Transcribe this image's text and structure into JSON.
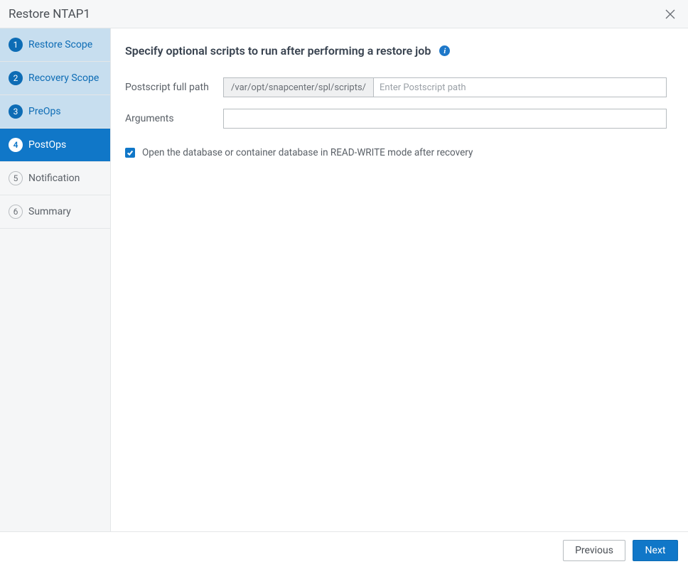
{
  "header": {
    "title": "Restore NTAP1"
  },
  "sidebar": {
    "steps": [
      {
        "num": "1",
        "label": "Restore Scope"
      },
      {
        "num": "2",
        "label": "Recovery Scope"
      },
      {
        "num": "3",
        "label": "PreOps"
      },
      {
        "num": "4",
        "label": "PostOps"
      },
      {
        "num": "5",
        "label": "Notification"
      },
      {
        "num": "6",
        "label": "Summary"
      }
    ]
  },
  "main": {
    "heading": "Specify optional scripts to run after performing a restore job",
    "postscript_label": "Postscript full path",
    "postscript_prefix": "/var/opt/snapcenter/spl/scripts/",
    "postscript_placeholder": "Enter Postscript path",
    "postscript_value": "",
    "arguments_label": "Arguments",
    "arguments_value": "",
    "checkbox_label": "Open the database or container database in READ-WRITE mode after recovery"
  },
  "footer": {
    "previous": "Previous",
    "next": "Next"
  }
}
